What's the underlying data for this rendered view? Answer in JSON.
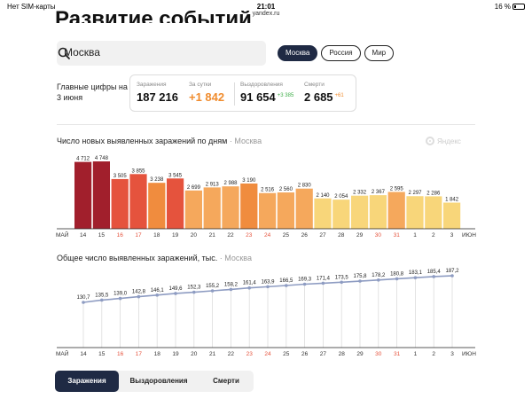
{
  "status_bar": {
    "carrier": "Нет SIM-карты",
    "time": "21:01",
    "url": "yandex.ru",
    "battery": "16 %"
  },
  "page": {
    "title": "Развитие событий"
  },
  "search": {
    "value": "Москва"
  },
  "regions": [
    {
      "label": "Москва",
      "active": true
    },
    {
      "label": "Россия",
      "active": false
    },
    {
      "label": "Мир",
      "active": false
    }
  ],
  "summary": {
    "label": "Главные цифры на 3 июня",
    "stats": [
      {
        "label": "Заражения",
        "value": "187 216",
        "delta": ""
      },
      {
        "label": "За сутки",
        "value": "+1 842",
        "delta": ""
      },
      {
        "label": "Выздоровления",
        "value": "91 654",
        "delta": "+3 385"
      },
      {
        "label": "Смерти",
        "value": "2 685",
        "delta": "+61"
      }
    ]
  },
  "watermark": "Яндекс",
  "charts_meta": {
    "daily_title": "Число новых выявленных заражений по дням",
    "daily_region": "Москва",
    "total_title": "Общее число выявленных заражений, тыс.",
    "total_region": "Москва",
    "month_start": "МАЙ",
    "month_end": "ИЮН"
  },
  "colors": {
    "bar_dark": "#a11f2c",
    "bar_red": "#e5533d",
    "bar_orange": "#f08c3e",
    "bar_light_orange": "#f5a85c",
    "bar_yellow": "#f8d67a",
    "line": "#8e9cc2",
    "accent": "#1f2a44"
  },
  "chart_data": [
    {
      "type": "bar",
      "title": "Число новых выявленных заражений по дням",
      "categories": [
        "14",
        "15",
        "16",
        "17",
        "18",
        "19",
        "20",
        "21",
        "22",
        "23",
        "24",
        "25",
        "26",
        "27",
        "28",
        "29",
        "30",
        "31",
        "1",
        "2",
        "3"
      ],
      "values": [
        4712,
        4748,
        3505,
        3855,
        3238,
        3545,
        2699,
        2913,
        2988,
        3190,
        2516,
        2560,
        2830,
        2140,
        2054,
        2332,
        2367,
        2595,
        2297,
        2286,
        1842
      ],
      "labels": [
        "4 712",
        "4 748",
        "3 505",
        "3 855",
        "3 238",
        "3 545",
        "2 699",
        "2 913",
        "2 988",
        "3 190",
        "2 516",
        "2 560",
        "2 830",
        "2 140",
        "2 054",
        "2 332",
        "2 367",
        "2 595",
        "2 297",
        "2 286",
        "1 842"
      ],
      "red_ticks": [
        "16",
        "17",
        "23",
        "24",
        "30",
        "31"
      ],
      "ylim": [
        0,
        5000
      ],
      "grid": false
    },
    {
      "type": "line",
      "title": "Общее число выявленных заражений, тыс.",
      "categories": [
        "14",
        "15",
        "16",
        "17",
        "18",
        "19",
        "20",
        "21",
        "22",
        "23",
        "24",
        "25",
        "26",
        "27",
        "28",
        "29",
        "30",
        "31",
        "1",
        "2",
        "3"
      ],
      "values": [
        130.7,
        135.5,
        139.0,
        142.8,
        146.1,
        149.6,
        152.3,
        155.2,
        158.2,
        161.4,
        163.9,
        166.5,
        169.3,
        171.4,
        173.5,
        175.8,
        178.2,
        180.8,
        183.1,
        185.4,
        187.2
      ],
      "labels": [
        "130,7",
        "135,5",
        "139,0",
        "142,8",
        "146,1",
        "149,6",
        "152,3",
        "155,2",
        "158,2",
        "161,4",
        "163,9",
        "166,5",
        "169,3",
        "171,4",
        "173,5",
        "175,8",
        "178,2",
        "180,8",
        "183,1",
        "185,4",
        "187,2"
      ],
      "red_ticks": [
        "16",
        "17",
        "23",
        "24",
        "30",
        "31"
      ],
      "grid": false
    }
  ],
  "tabs": [
    {
      "label": "Заражения",
      "active": true
    },
    {
      "label": "Выздоровления",
      "active": false
    },
    {
      "label": "Смерти",
      "active": false
    }
  ]
}
